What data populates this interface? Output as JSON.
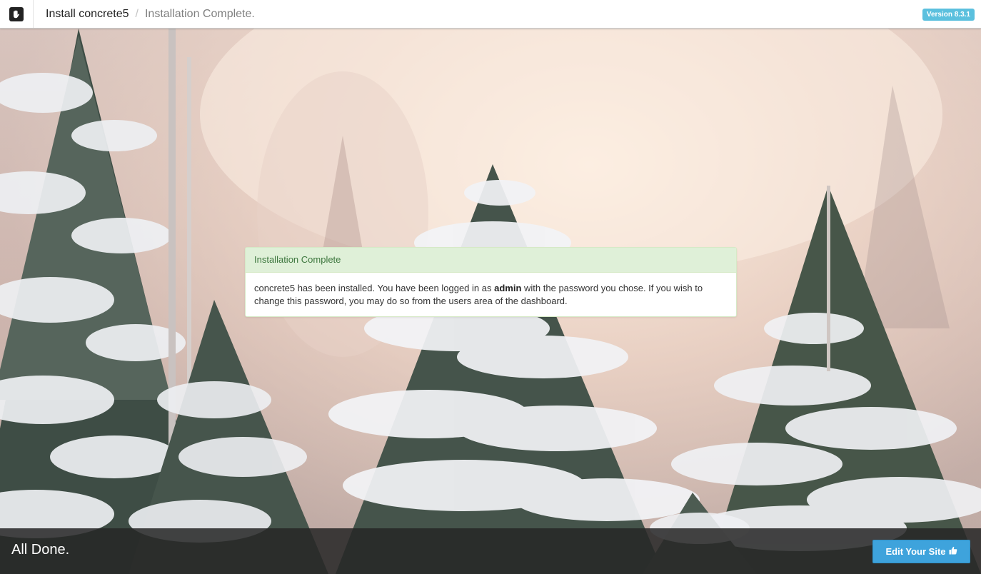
{
  "header": {
    "breadcrumb": [
      "Install concrete5",
      "Installation Complete."
    ],
    "separator": "/",
    "version_badge": "Version 8.3.1"
  },
  "alert": {
    "title": "Installation Complete",
    "message_before": "concrete5 has been installed. You have been logged in as",
    "username": "admin",
    "message_after": "with the password you chose. If you wish to change this password, you may do so from the users area of the dashboard."
  },
  "footer": {
    "status": "All Done.",
    "button_label": "Edit Your Site",
    "button_icon": "thumbs-up-icon"
  },
  "colors": {
    "badge": "#5bc0de",
    "alert_header_bg": "#dff0d8",
    "alert_header_text": "#3c763d",
    "button": "#3ea3dc",
    "footer_bg": "#262626"
  }
}
